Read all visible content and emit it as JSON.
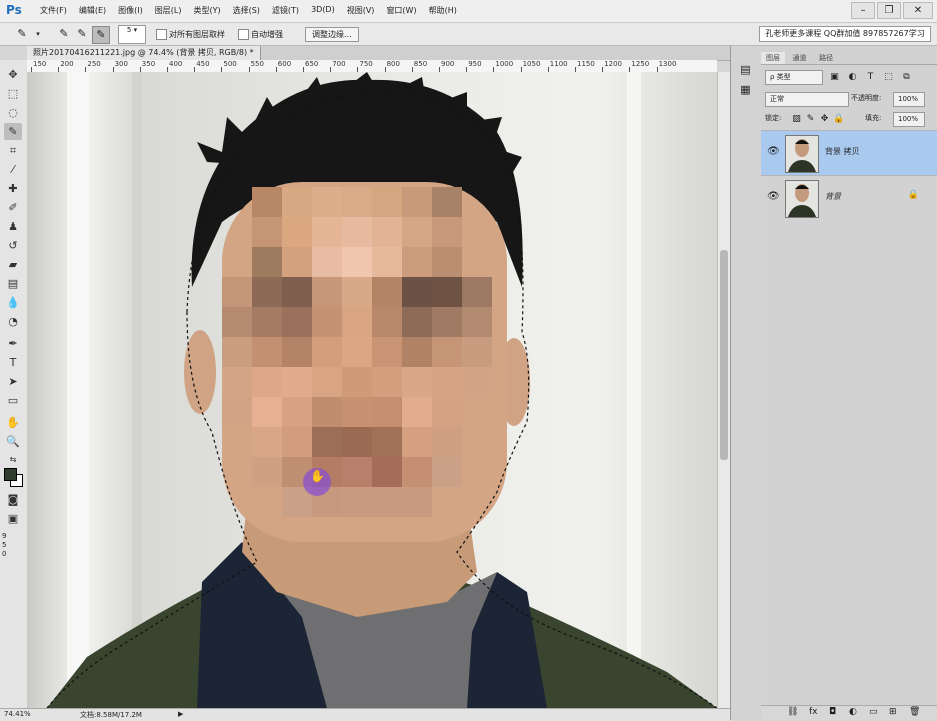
{
  "app": {
    "logo": "Ps",
    "menus": [
      "文件(F)",
      "编辑(E)",
      "图像(I)",
      "图层(L)",
      "类型(Y)",
      "选择(S)",
      "滤镜(T)",
      "3D(D)",
      "视图(V)",
      "窗口(W)",
      "帮助(H)"
    ],
    "window_buttons": {
      "minimize": "–",
      "restore": "❐",
      "close": "✕"
    }
  },
  "options": {
    "brush_size": "5",
    "sample_all_layers_label": "对所有图层取样",
    "auto_enhance_label": "自动增强",
    "refine_edge_label": "调整边缘...",
    "promo_text": "孔老师更多课程 QQ群加值 897857267学习"
  },
  "document": {
    "tab_title": "照片20170416211221.jpg @ 74.4% (背景 拷贝, RGB/8) *",
    "ruler_ticks": [
      "150",
      "200",
      "250",
      "300",
      "350",
      "400",
      "450",
      "500",
      "550",
      "600",
      "650",
      "700",
      "750",
      "800",
      "850",
      "900",
      "950",
      "1000",
      "1050",
      "1100",
      "1150",
      "1200",
      "1250",
      "1300"
    ],
    "vertical_ruler_ticks": [
      "9",
      "5",
      "0"
    ]
  },
  "status": {
    "zoom": "74.41%",
    "doc_size": "文档:8.58M/17.2M"
  },
  "layers_panel": {
    "tabs": [
      "图层",
      "通道",
      "路径"
    ],
    "filter_label": "ρ 类型",
    "blend_mode": "正常",
    "opacity_label": "不透明度:",
    "opacity_value": "100%",
    "lock_label": "锁定:",
    "fill_label": "填充:",
    "fill_value": "100%",
    "layers": [
      {
        "name": "背景 拷贝",
        "active": true
      },
      {
        "name": "背景",
        "active": false
      }
    ]
  },
  "colors": {
    "selected_layer": "#a9c9ef",
    "foreground": "#2f3d2c",
    "background": "#ffffff",
    "brush_cursor": "#8a4fcf"
  }
}
